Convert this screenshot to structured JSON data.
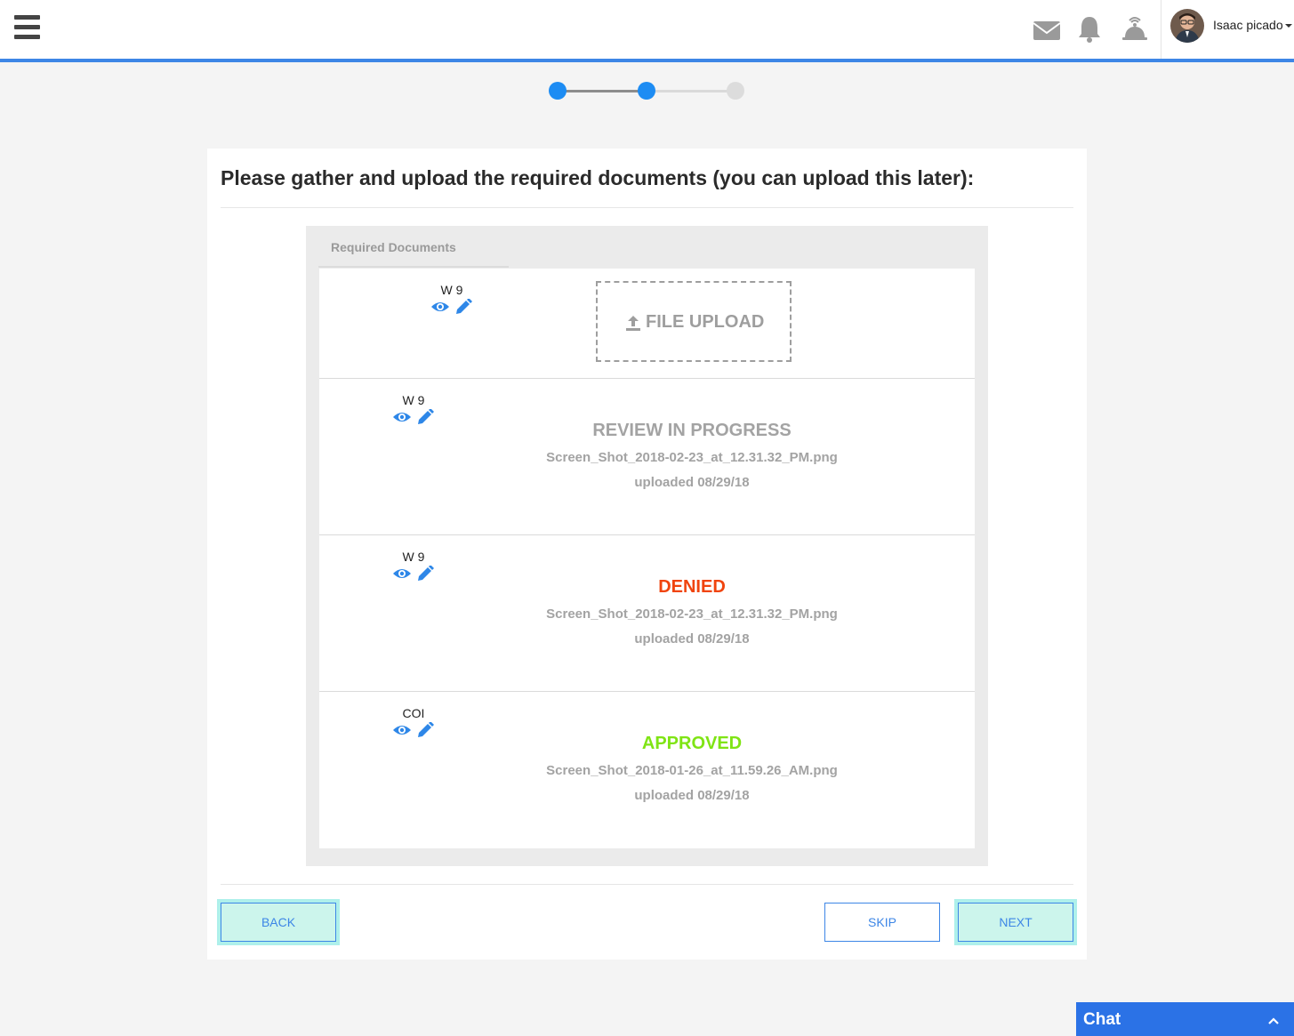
{
  "header": {
    "user_name": "Isaac picado"
  },
  "stepper": {
    "current_step": 2,
    "total_steps": 3
  },
  "card": {
    "title": "Please gather and upload the required documents (you can upload this later):"
  },
  "docs": {
    "header": "Required Documents",
    "upload_label": "FILE UPLOAD",
    "rows": [
      {
        "name": "W 9"
      },
      {
        "name": "W 9",
        "status": "REVIEW IN PROGRESS",
        "file": "Screen_Shot_2018-02-23_at_12.31.32_PM.png",
        "uploaded": "uploaded 08/29/18"
      },
      {
        "name": "W 9",
        "status": "DENIED",
        "file": "Screen_Shot_2018-02-23_at_12.31.32_PM.png",
        "uploaded": "uploaded 08/29/18"
      },
      {
        "name": "COI",
        "status": "APPROVED",
        "file": "Screen_Shot_2018-01-26_at_11.59.26_AM.png",
        "uploaded": "uploaded 08/29/18"
      }
    ]
  },
  "status_colors": {
    "review": "#a3a3a3",
    "denied": "#f0440e",
    "approved": "#7fe414"
  },
  "accent_color": "#3d86e6",
  "buttons": {
    "back": "BACK",
    "skip": "SKIP",
    "next": "NEXT"
  },
  "chat": {
    "label": "Chat"
  }
}
